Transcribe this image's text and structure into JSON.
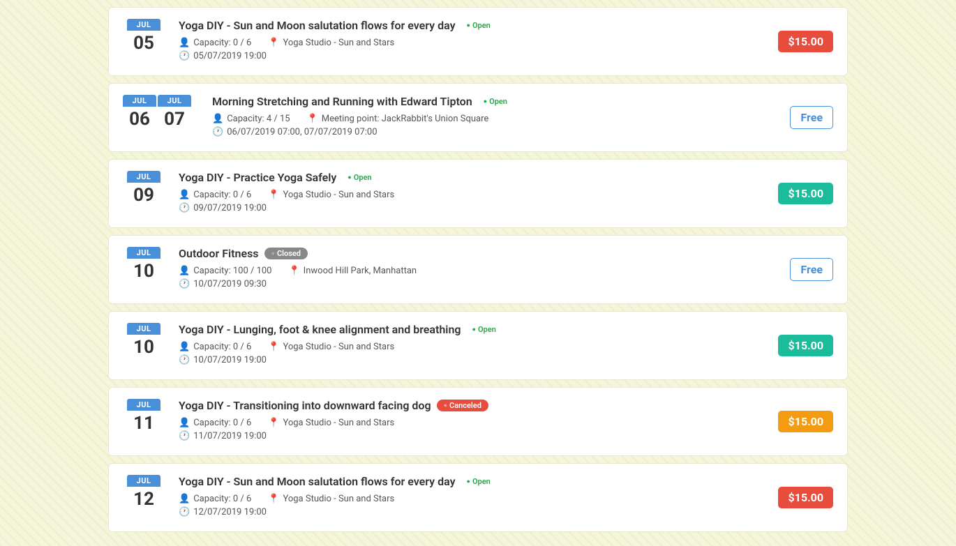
{
  "events": [
    {
      "id": "event-1",
      "month": "JUL",
      "day": "05",
      "title": "Yoga DIY - Sun and Moon salutation flows for every day",
      "status": "Open",
      "status_type": "open",
      "capacity": "Capacity: 0 / 6",
      "location": "Yoga Studio - Sun and Stars",
      "datetime": "05/07/2019 19:00",
      "price": "$15.00",
      "price_type": "red",
      "double_date": false
    },
    {
      "id": "event-2",
      "month": "JUL",
      "day": "06",
      "month2": "JUL",
      "day2": "07",
      "title": "Morning Stretching and Running with Edward Tipton",
      "status": "Open",
      "status_type": "open",
      "capacity": "Capacity: 4 / 15",
      "location": "Meeting point: JackRabbit's Union Square",
      "datetime": "06/07/2019 07:00, 07/07/2019 07:00",
      "price": "Free",
      "price_type": "free",
      "double_date": true
    },
    {
      "id": "event-3",
      "month": "JUL",
      "day": "09",
      "title": "Yoga DIY - Practice Yoga Safely",
      "status": "Open",
      "status_type": "open",
      "capacity": "Capacity: 0 / 6",
      "location": "Yoga Studio - Sun and Stars",
      "datetime": "09/07/2019 19:00",
      "price": "$15.00",
      "price_type": "teal",
      "double_date": false
    },
    {
      "id": "event-4",
      "month": "JUL",
      "day": "10",
      "title": "Outdoor Fitness",
      "status": "Closed",
      "status_type": "closed",
      "capacity": "Capacity: 100 / 100",
      "location": "Inwood Hill Park, Manhattan",
      "datetime": "10/07/2019 09:30",
      "price": "Free",
      "price_type": "free",
      "double_date": false
    },
    {
      "id": "event-5",
      "month": "JUL",
      "day": "10",
      "title": "Yoga DIY - Lunging, foot & knee alignment and breathing",
      "status": "Open",
      "status_type": "open",
      "capacity": "Capacity: 0 / 6",
      "location": "Yoga Studio - Sun and Stars",
      "datetime": "10/07/2019 19:00",
      "price": "$15.00",
      "price_type": "teal",
      "double_date": false
    },
    {
      "id": "event-6",
      "month": "JUL",
      "day": "11",
      "title": "Yoga DIY - Transitioning into downward facing dog",
      "status": "Canceled",
      "status_type": "canceled",
      "capacity": "Capacity: 0 / 6",
      "location": "Yoga Studio - Sun and Stars",
      "datetime": "11/07/2019 19:00",
      "price": "$15.00",
      "price_type": "orange",
      "double_date": false
    },
    {
      "id": "event-7",
      "month": "JUL",
      "day": "12",
      "title": "Yoga DIY - Sun and Moon salutation flows for every day",
      "status": "Open",
      "status_type": "open",
      "capacity": "Capacity: 0 / 6",
      "location": "Yoga Studio - Sun and Stars",
      "datetime": "12/07/2019 19:00",
      "price": "$15.00",
      "price_type": "red",
      "double_date": false
    }
  ]
}
